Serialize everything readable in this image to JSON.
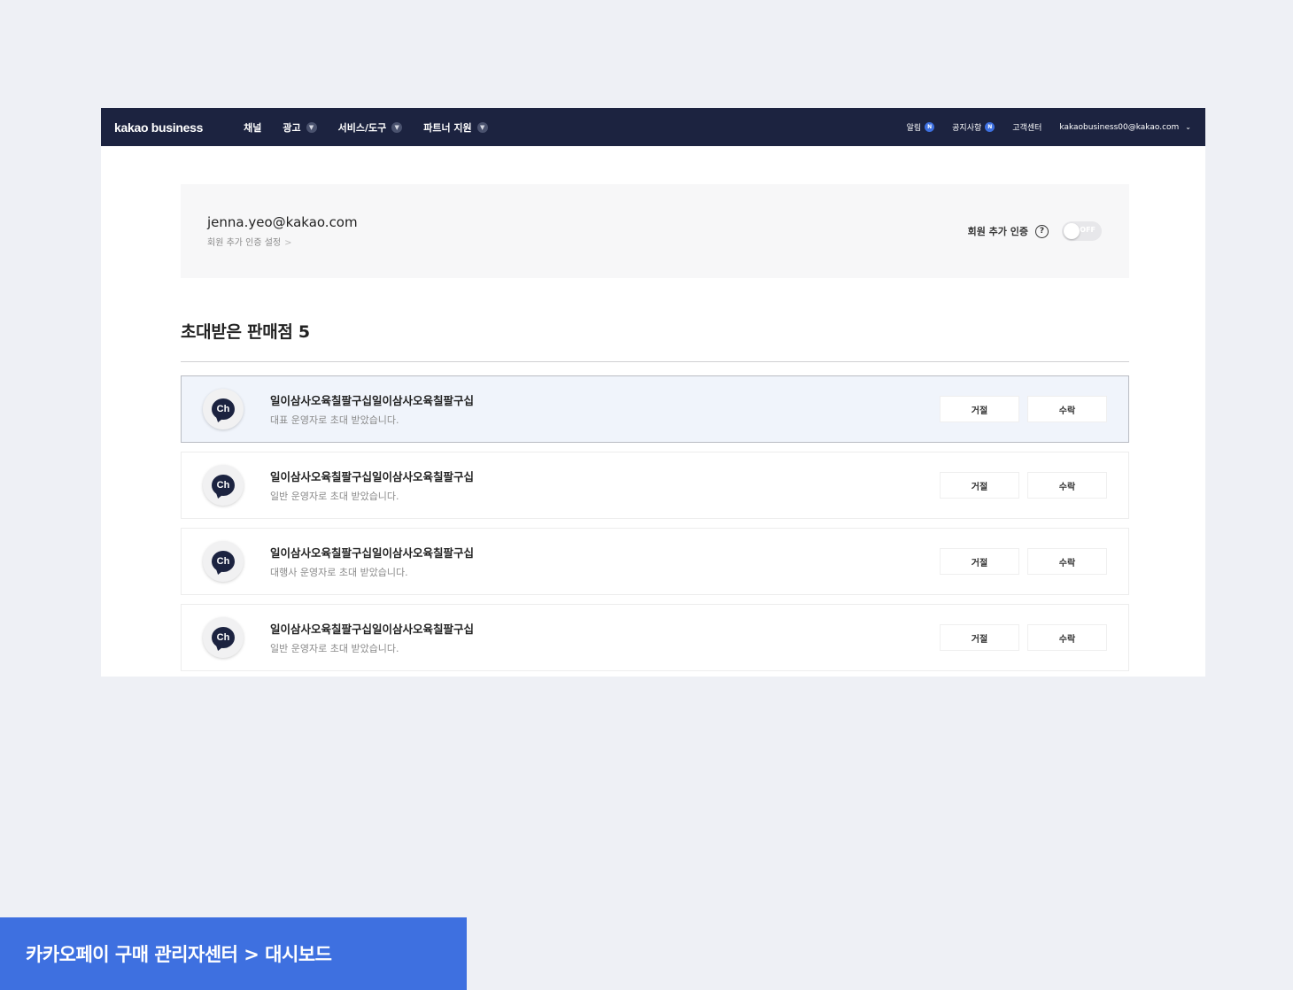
{
  "nav": {
    "logo": "kakao business",
    "menu": [
      {
        "label": "채널",
        "has_dropdown": false
      },
      {
        "label": "광고",
        "has_dropdown": true
      },
      {
        "label": "서비스/도구",
        "has_dropdown": true
      },
      {
        "label": "파트너 지원",
        "has_dropdown": true
      }
    ],
    "right": {
      "alarm_label": "알림",
      "alarm_badge": "N",
      "notice_label": "공지사항",
      "notice_badge": "N",
      "support_label": "고객센터",
      "account_email": "kakaobusiness00@kakao.com"
    }
  },
  "profile": {
    "email": "jenna.yeo@kakao.com",
    "setting_link": "회원 추가 인증 설정",
    "auth_label": "회원 추가 인증",
    "toggle_state": "OFF"
  },
  "section": {
    "title": "초대받은 판매점 5"
  },
  "stores": [
    {
      "name": "일이삼사오육칠팔구십일이삼사오육칠팔구십",
      "desc": "대표 운영자로 초대 받았습니다.",
      "reject": "거절",
      "accept": "수락",
      "selected": true
    },
    {
      "name": "일이삼사오육칠팔구십일이삼사오육칠팔구십",
      "desc": "일반 운영자로 초대 받았습니다.",
      "reject": "거절",
      "accept": "수락",
      "selected": false
    },
    {
      "name": "일이삼사오육칠팔구십일이삼사오육칠팔구십",
      "desc": "대행사 운영자로 초대 받았습니다.",
      "reject": "거절",
      "accept": "수락",
      "selected": false
    },
    {
      "name": "일이삼사오육칠팔구십일이삼사오육칠팔구십",
      "desc": "일반 운영자로 초대 받았습니다.",
      "reject": "거절",
      "accept": "수락",
      "selected": false
    }
  ],
  "avatar_glyph": "Ch",
  "caption": "카카오페이 구매 관리자센터 > 대시보드",
  "colors": {
    "nav_bg": "#1c2340",
    "accent": "#3e70e0",
    "page_bg": "#eef0f5",
    "selected_row_bg": "#f0f4fb"
  }
}
